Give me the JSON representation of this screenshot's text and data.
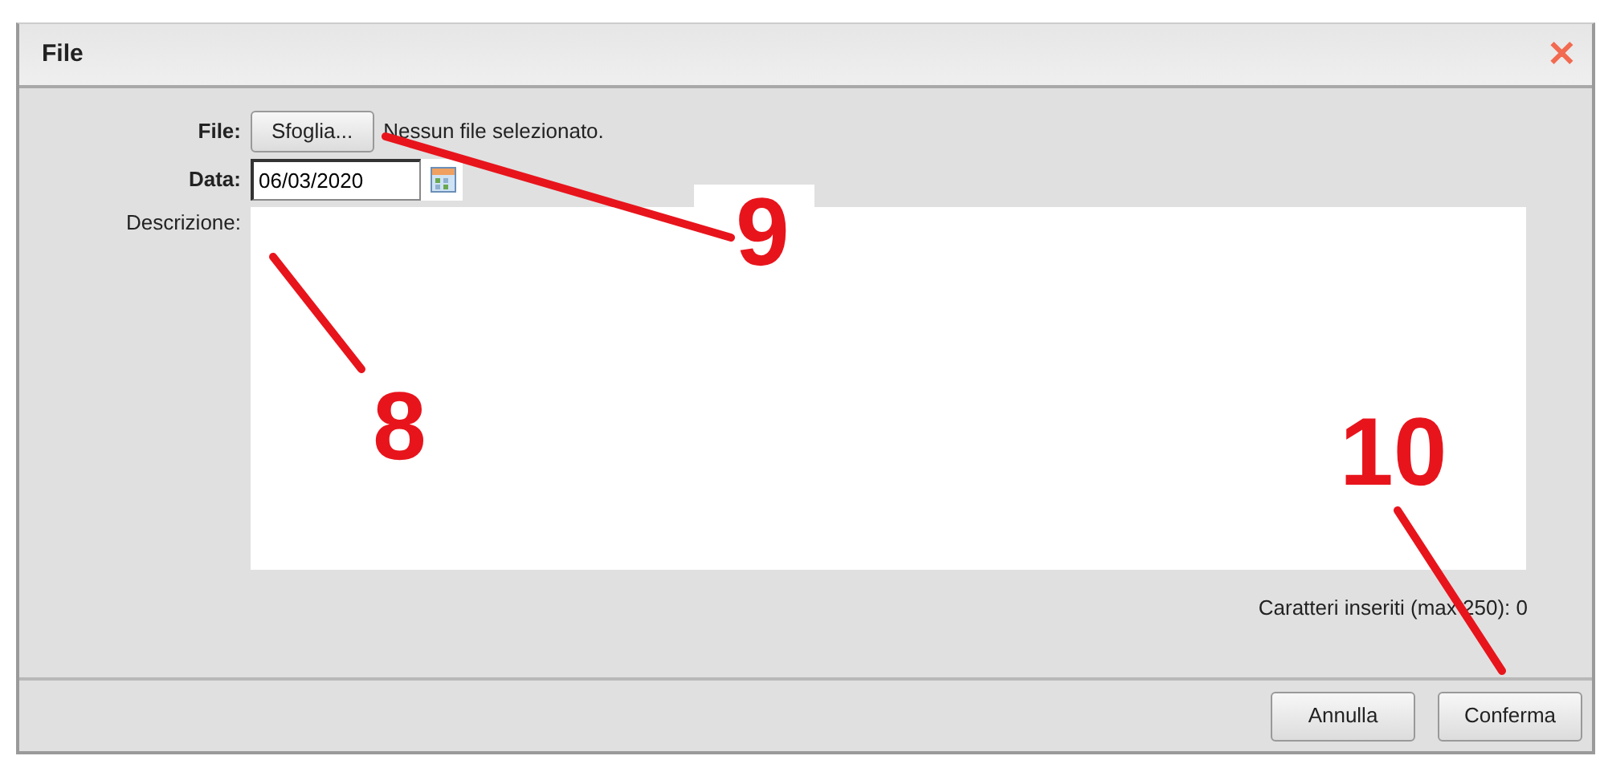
{
  "window": {
    "title": "File",
    "close": "✕"
  },
  "form": {
    "file_label": "File:",
    "browse_button": "Sfoglia...",
    "file_status": "Nessun file selezionato.",
    "date_label": "Data:",
    "date_value": "06/03/2020",
    "description_label": "Descrizione:",
    "counter": "Caratteri inseriti (max 250): 0"
  },
  "buttons": [
    {
      "label": "Annulla"
    },
    {
      "label": "Conferma"
    }
  ],
  "annotations": [
    {
      "label": "9",
      "backed": true
    },
    {
      "label": "8",
      "backed": false
    },
    {
      "label": "10",
      "backed": false
    }
  ]
}
